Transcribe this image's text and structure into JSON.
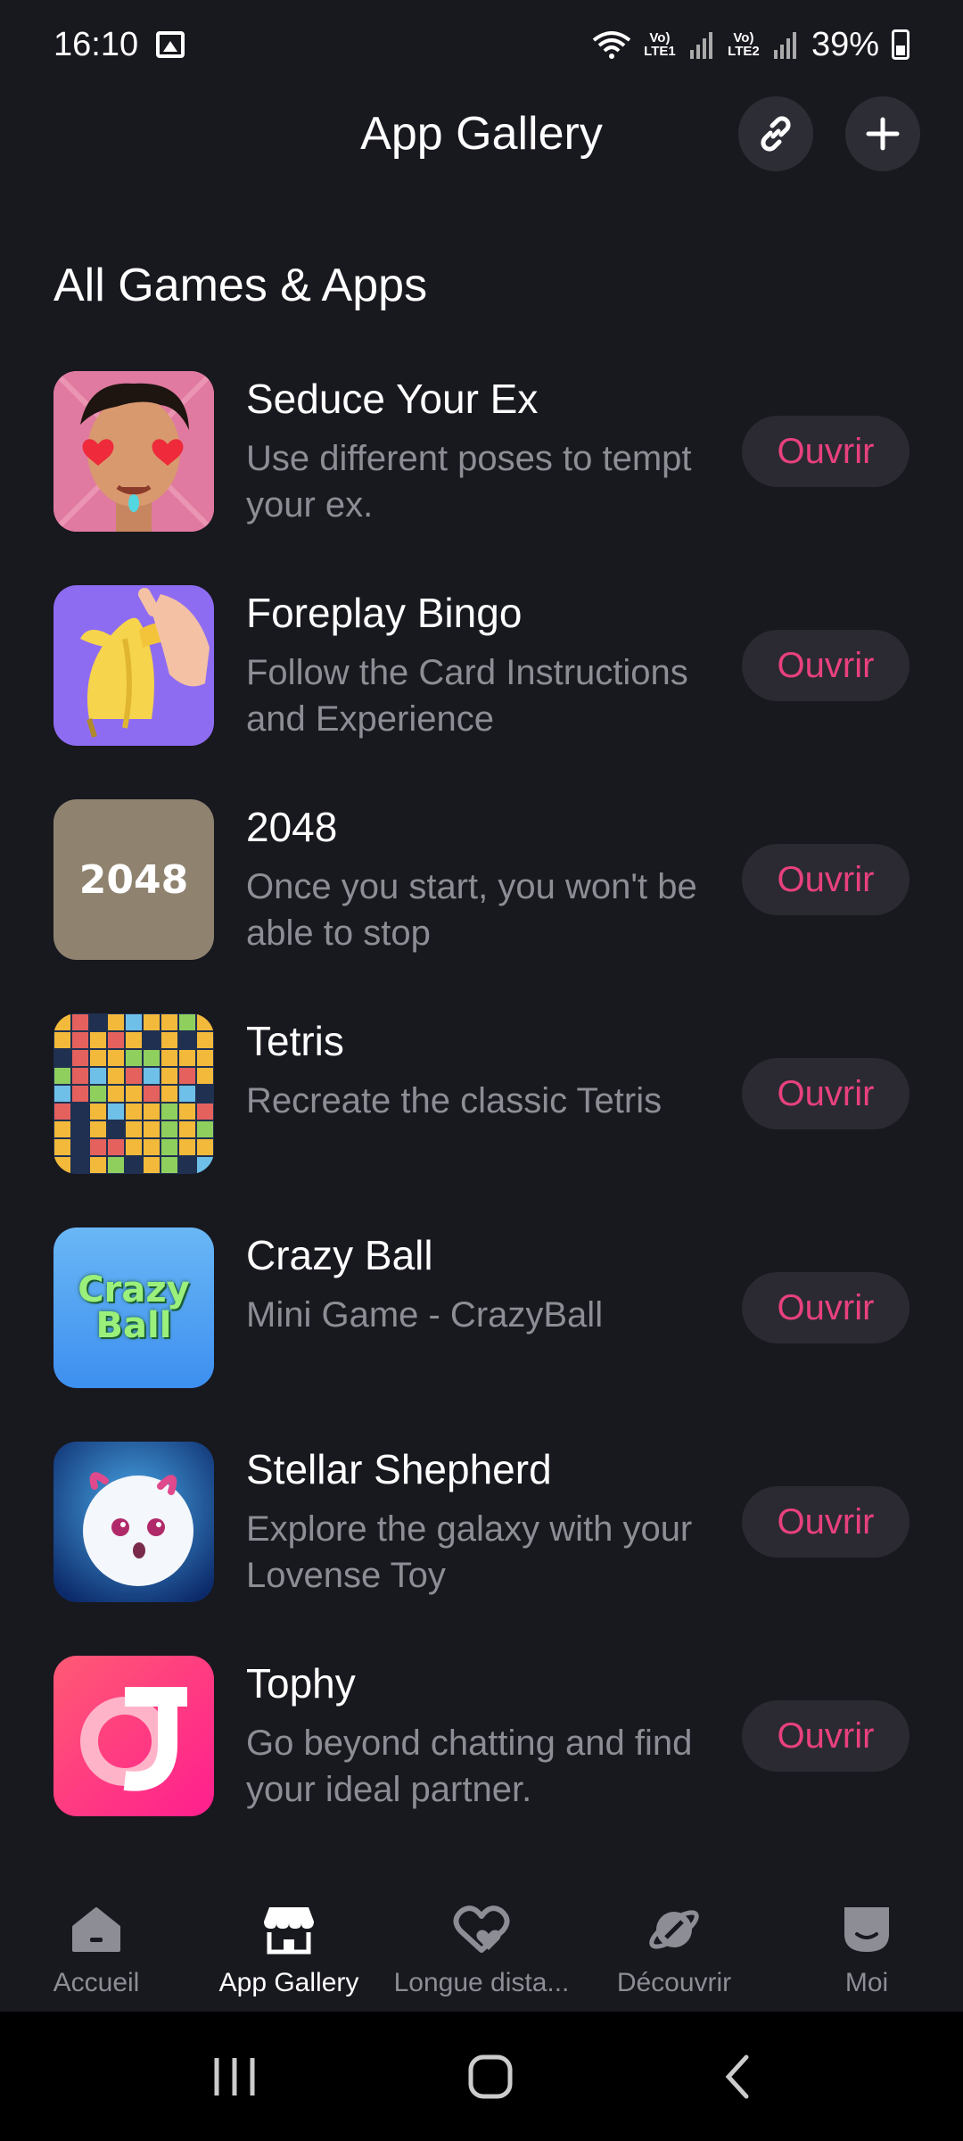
{
  "status_bar": {
    "time": "16:10",
    "sim1": "Vo) LTE1",
    "sim2": "Vo) LTE2",
    "battery": "39%"
  },
  "header": {
    "title": "App Gallery",
    "link_icon": "link-icon",
    "add_icon": "plus-icon"
  },
  "section_title": "All Games & Apps",
  "open_label": "Ouvrir",
  "apps": [
    {
      "title": "Seduce Your Ex",
      "desc": "Use different poses to tempt your ex."
    },
    {
      "title": "Foreplay Bingo",
      "desc": "Follow the Card Instructions and Experience"
    },
    {
      "title": "2048",
      "desc": "Once you start, you won't be able to stop",
      "icon_text": "2048"
    },
    {
      "title": "Tetris",
      "desc": "Recreate the classic Tetris"
    },
    {
      "title": "Crazy Ball",
      "desc": "Mini Game - CrazyBall",
      "icon_text": "Crazy Ball"
    },
    {
      "title": "Stellar Shepherd",
      "desc": "Explore the galaxy with your Lovense Toy"
    },
    {
      "title": "Tophy",
      "desc": "Go beyond chatting and find your ideal partner."
    }
  ],
  "nav": {
    "items": [
      {
        "label": "Accueil",
        "icon": "home-icon"
      },
      {
        "label": "App Gallery",
        "icon": "store-icon"
      },
      {
        "label": "Longue dista...",
        "icon": "heart-icon"
      },
      {
        "label": "Découvrir",
        "icon": "planet-icon"
      },
      {
        "label": "Moi",
        "icon": "face-icon"
      }
    ]
  },
  "colors": {
    "background": "#18181f",
    "accent": "#e8417d",
    "button_bg": "#2b2a33",
    "muted_text": "#8d8d96"
  }
}
